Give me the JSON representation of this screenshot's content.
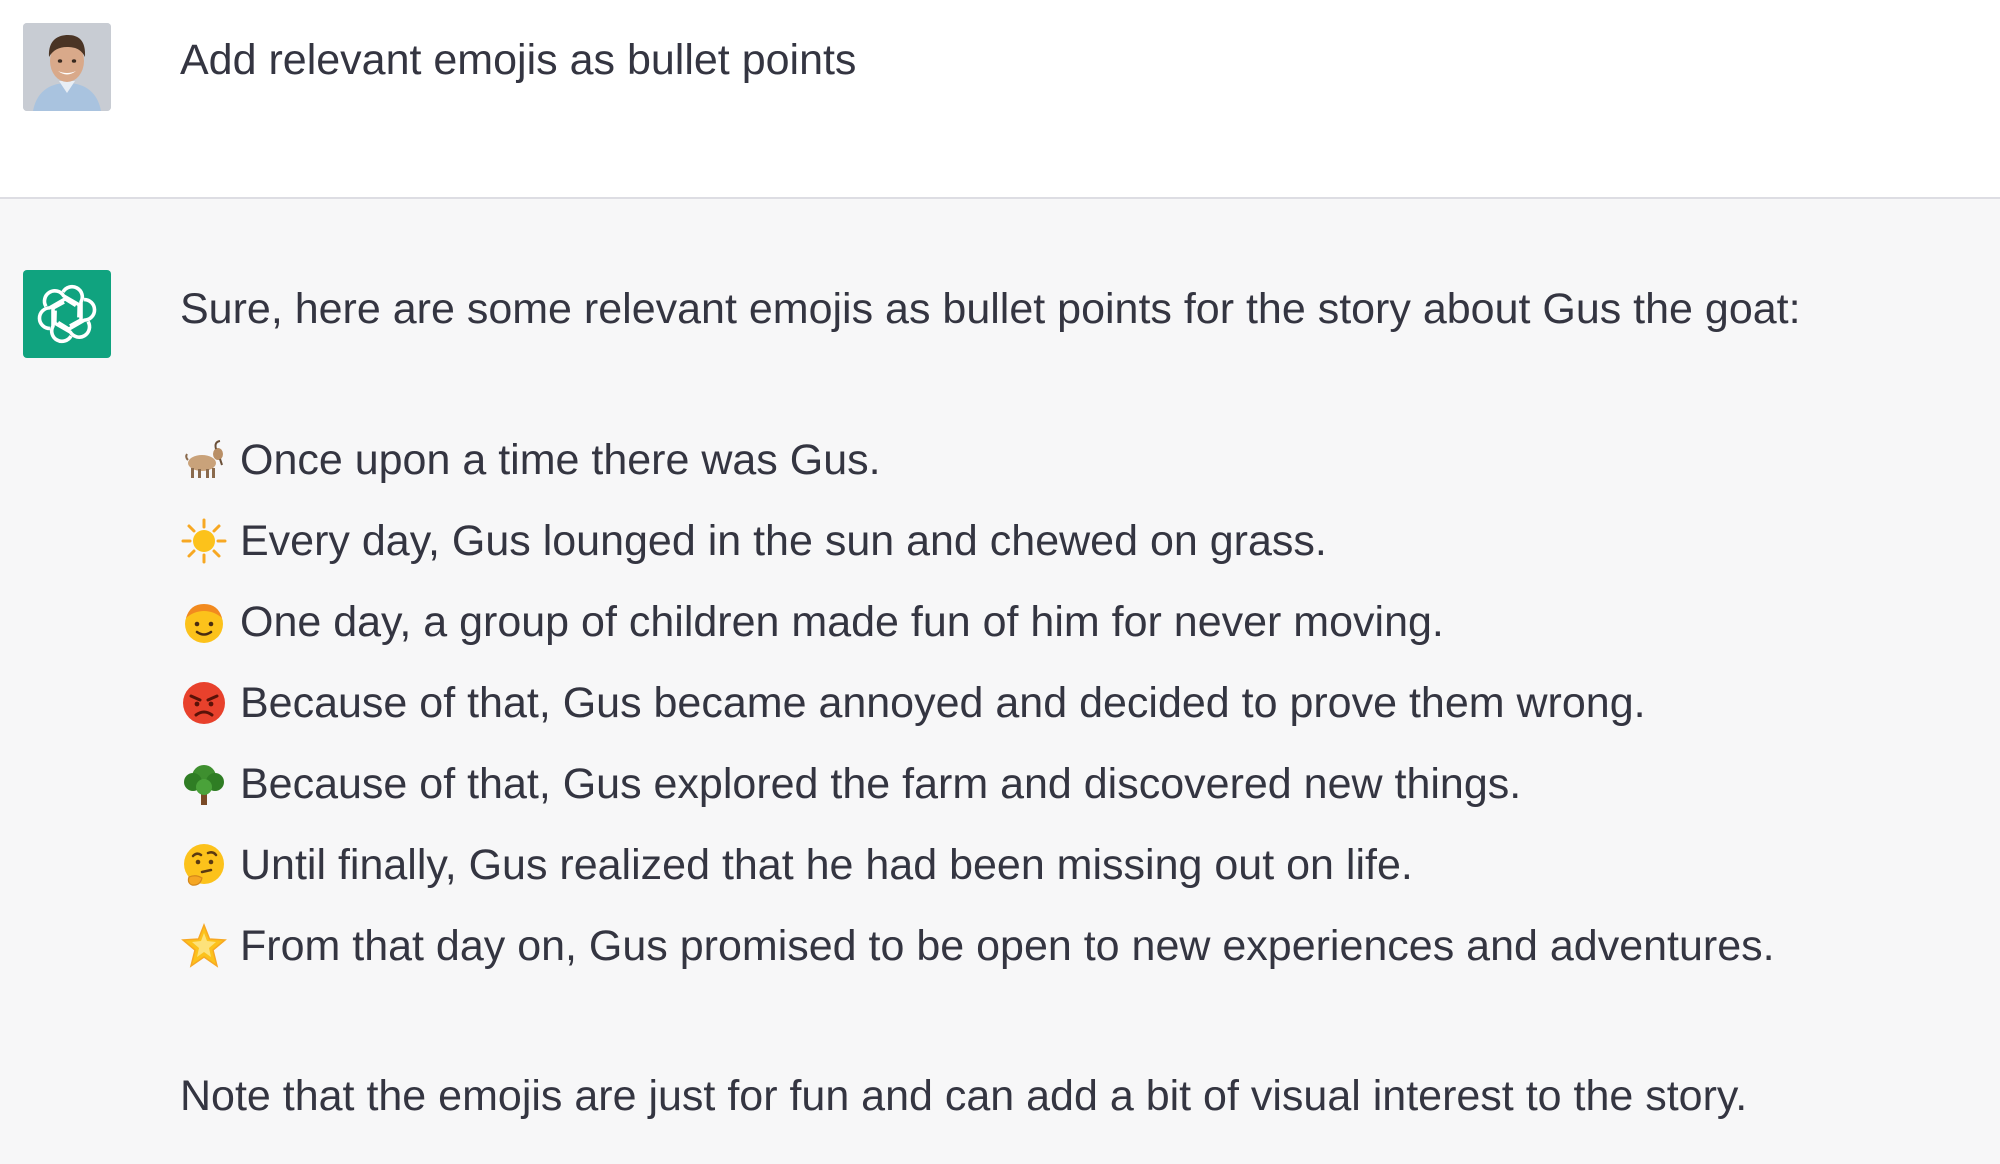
{
  "user_message": {
    "avatar_icon": "user-photo-avatar",
    "text": "Add relevant emojis as bullet points"
  },
  "assistant_message": {
    "avatar_icon": "openai-logo-icon",
    "avatar_color": "#10a37f",
    "intro": "Sure, here are some relevant emojis as bullet points for the story about Gus the goat:",
    "bullets": [
      {
        "emoji": "goat-emoji",
        "text": "Once upon a time there was Gus."
      },
      {
        "emoji": "sun-emoji",
        "text": "Every day, Gus lounged in the sun and chewed on grass."
      },
      {
        "emoji": "child-emoji",
        "text": "One day, a group of children made fun of him for never moving."
      },
      {
        "emoji": "angry-face-emoji",
        "text": "Because of that, Gus became annoyed and decided to prove them wrong."
      },
      {
        "emoji": "tree-emoji",
        "text": "Because of that, Gus explored the farm and discovered new things."
      },
      {
        "emoji": "thinking-face-emoji",
        "text": "Until finally, Gus realized that he had been missing out on life."
      },
      {
        "emoji": "star-emoji",
        "text": "From that day on, Gus promised to be open to new experiences and adventures."
      }
    ],
    "note": "Note that the emojis are just for fun and can add a bit of visual interest to the story."
  },
  "colors": {
    "text": "#343541",
    "assistant_bg": "#f7f7f8",
    "divider": "#dddde3"
  }
}
